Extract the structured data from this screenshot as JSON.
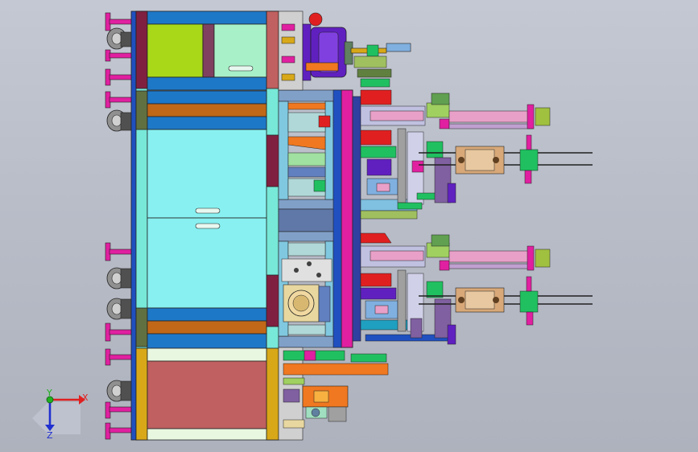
{
  "viewport": {
    "background_top": "#c4c8d2",
    "background_bottom": "#aeb2bd"
  },
  "triad": {
    "x_label": "X",
    "y_label": "Y",
    "z_label": "Z",
    "x_color": "#e02020",
    "y_color": "#20b020",
    "z_color": "#2030d0"
  },
  "palette": {
    "frame_blue": "#1e78c8",
    "frame_teal": "#78e8d8",
    "panel_cyan": "#88f0f0",
    "lime": "#a8d818",
    "mint": "#a8f0c8",
    "brown": "#c06818",
    "rose": "#c06060",
    "magenta": "#e020a0",
    "purple": "#6020c0",
    "olive": "#607040",
    "gold": "#d8a818",
    "maroon": "#802040",
    "pink": "#e8a0c8",
    "tan": "#d8a878",
    "green": "#20c060",
    "red": "#e02020",
    "orange": "#f07820"
  }
}
